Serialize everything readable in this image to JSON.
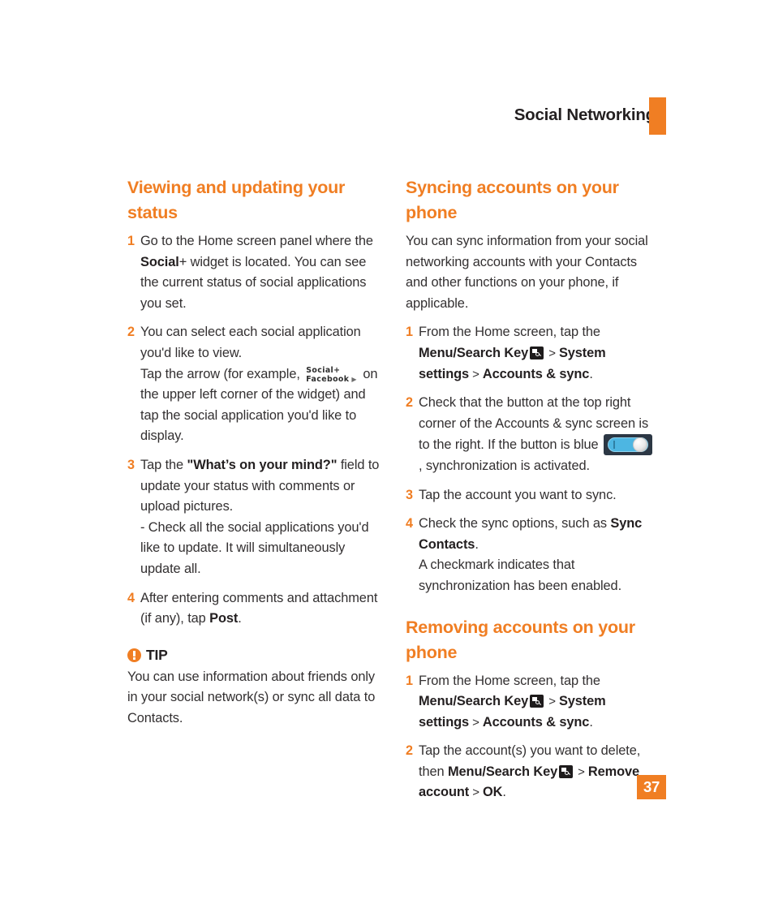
{
  "header": {
    "title": "Social Networking",
    "accent_color": "#f07e23"
  },
  "page_number": "37",
  "left_column": {
    "section_title": "Viewing and updating your status",
    "steps": [
      {
        "num": "1",
        "parts": [
          {
            "t": "Go to the Home screen panel where the ",
            "style": "normal"
          },
          {
            "t": "Social",
            "style": "bold"
          },
          {
            "t": "+ widget is located. You can see the current status of social applications you set.",
            "style": "normal"
          }
        ]
      },
      {
        "num": "2",
        "parts": [
          {
            "t": "You can select each social application you'd like to view.",
            "style": "normal"
          },
          {
            "t": "BREAK",
            "style": "break"
          },
          {
            "t": "Tap the arrow (for example, ",
            "style": "normal"
          },
          {
            "t": "WIDGET",
            "style": "widget"
          },
          {
            "t": " on the upper left corner of the widget) and tap the social application you'd like to display.",
            "style": "normal"
          }
        ]
      },
      {
        "num": "3",
        "parts": [
          {
            "t": "Tap the ",
            "style": "normal"
          },
          {
            "t": "\"What’s on your mind?\"",
            "style": "bold"
          },
          {
            "t": " field to update your status with comments or upload pictures.",
            "style": "normal"
          },
          {
            "t": "BREAK",
            "style": "break"
          },
          {
            "t": "- Check all the social applications you'd like to update. It will simultaneously update all.",
            "style": "normal"
          }
        ]
      },
      {
        "num": "4",
        "parts": [
          {
            "t": "After entering comments and attachment (if any), tap ",
            "style": "normal"
          },
          {
            "t": "Post",
            "style": "bold"
          },
          {
            "t": ".",
            "style": "normal"
          }
        ]
      }
    ],
    "widget_graphic": {
      "line1": "Social+",
      "line2": "Facebook",
      "arrow": "▶"
    },
    "tip": {
      "label": "TIP",
      "icon": "warning-exclamation-icon",
      "text": "You can use information about friends only in your social network(s) or sync all data to Contacts."
    }
  },
  "right_column": {
    "sections": [
      {
        "section_title": "Syncing accounts on your phone",
        "intro": "You can sync information from your social networking accounts with your Contacts and other functions on your phone, if applicable.",
        "steps": [
          {
            "num": "1",
            "parts": [
              {
                "t": "From the Home screen, tap the ",
                "style": "normal"
              },
              {
                "t": "Menu/Search Key",
                "style": "bold"
              },
              {
                "t": "KEYICON",
                "style": "keyicon"
              },
              {
                "t": " > ",
                "style": "gt"
              },
              {
                "t": "System settings",
                "style": "bold"
              },
              {
                "t": " > ",
                "style": "gt"
              },
              {
                "t": "Accounts & sync",
                "style": "bold"
              },
              {
                "t": ".",
                "style": "normal"
              }
            ]
          },
          {
            "num": "2",
            "parts": [
              {
                "t": "Check that the button at the top right corner of the Accounts & sync screen is to the right. If the button is blue ",
                "style": "normal"
              },
              {
                "t": "TOGGLE",
                "style": "toggle"
              },
              {
                "t": ", synchronization is activated.",
                "style": "normal"
              }
            ]
          },
          {
            "num": "3",
            "parts": [
              {
                "t": "Tap the account you want to sync.",
                "style": "normal"
              }
            ]
          },
          {
            "num": "4",
            "parts": [
              {
                "t": "Check the sync options, such as ",
                "style": "normal"
              },
              {
                "t": "Sync Contacts",
                "style": "bold"
              },
              {
                "t": ".",
                "style": "normal"
              },
              {
                "t": "BREAK",
                "style": "break"
              },
              {
                "t": "A checkmark indicates that synchronization has been enabled.",
                "style": "normal"
              }
            ]
          }
        ]
      },
      {
        "section_title": "Removing accounts on your phone",
        "intro": "",
        "steps": [
          {
            "num": "1",
            "parts": [
              {
                "t": "From the Home screen, tap the ",
                "style": "normal"
              },
              {
                "t": "Menu/Search Key",
                "style": "bold"
              },
              {
                "t": "KEYICON",
                "style": "keyicon"
              },
              {
                "t": " > ",
                "style": "gt"
              },
              {
                "t": "System settings",
                "style": "bold"
              },
              {
                "t": " > ",
                "style": "gt"
              },
              {
                "t": "Accounts & sync",
                "style": "bold"
              },
              {
                "t": ".",
                "style": "normal"
              }
            ]
          },
          {
            "num": "2",
            "parts": [
              {
                "t": "Tap the account(s) you want to delete, then ",
                "style": "normal"
              },
              {
                "t": "Menu/Search Key",
                "style": "bold"
              },
              {
                "t": "KEYICON",
                "style": "keyicon"
              },
              {
                "t": " > ",
                "style": "gt"
              },
              {
                "t": "Remove account",
                "style": "bold"
              },
              {
                "t": " > ",
                "style": "gt"
              },
              {
                "t": "OK",
                "style": "bold"
              },
              {
                "t": ".",
                "style": "normal"
              }
            ]
          }
        ]
      }
    ]
  }
}
